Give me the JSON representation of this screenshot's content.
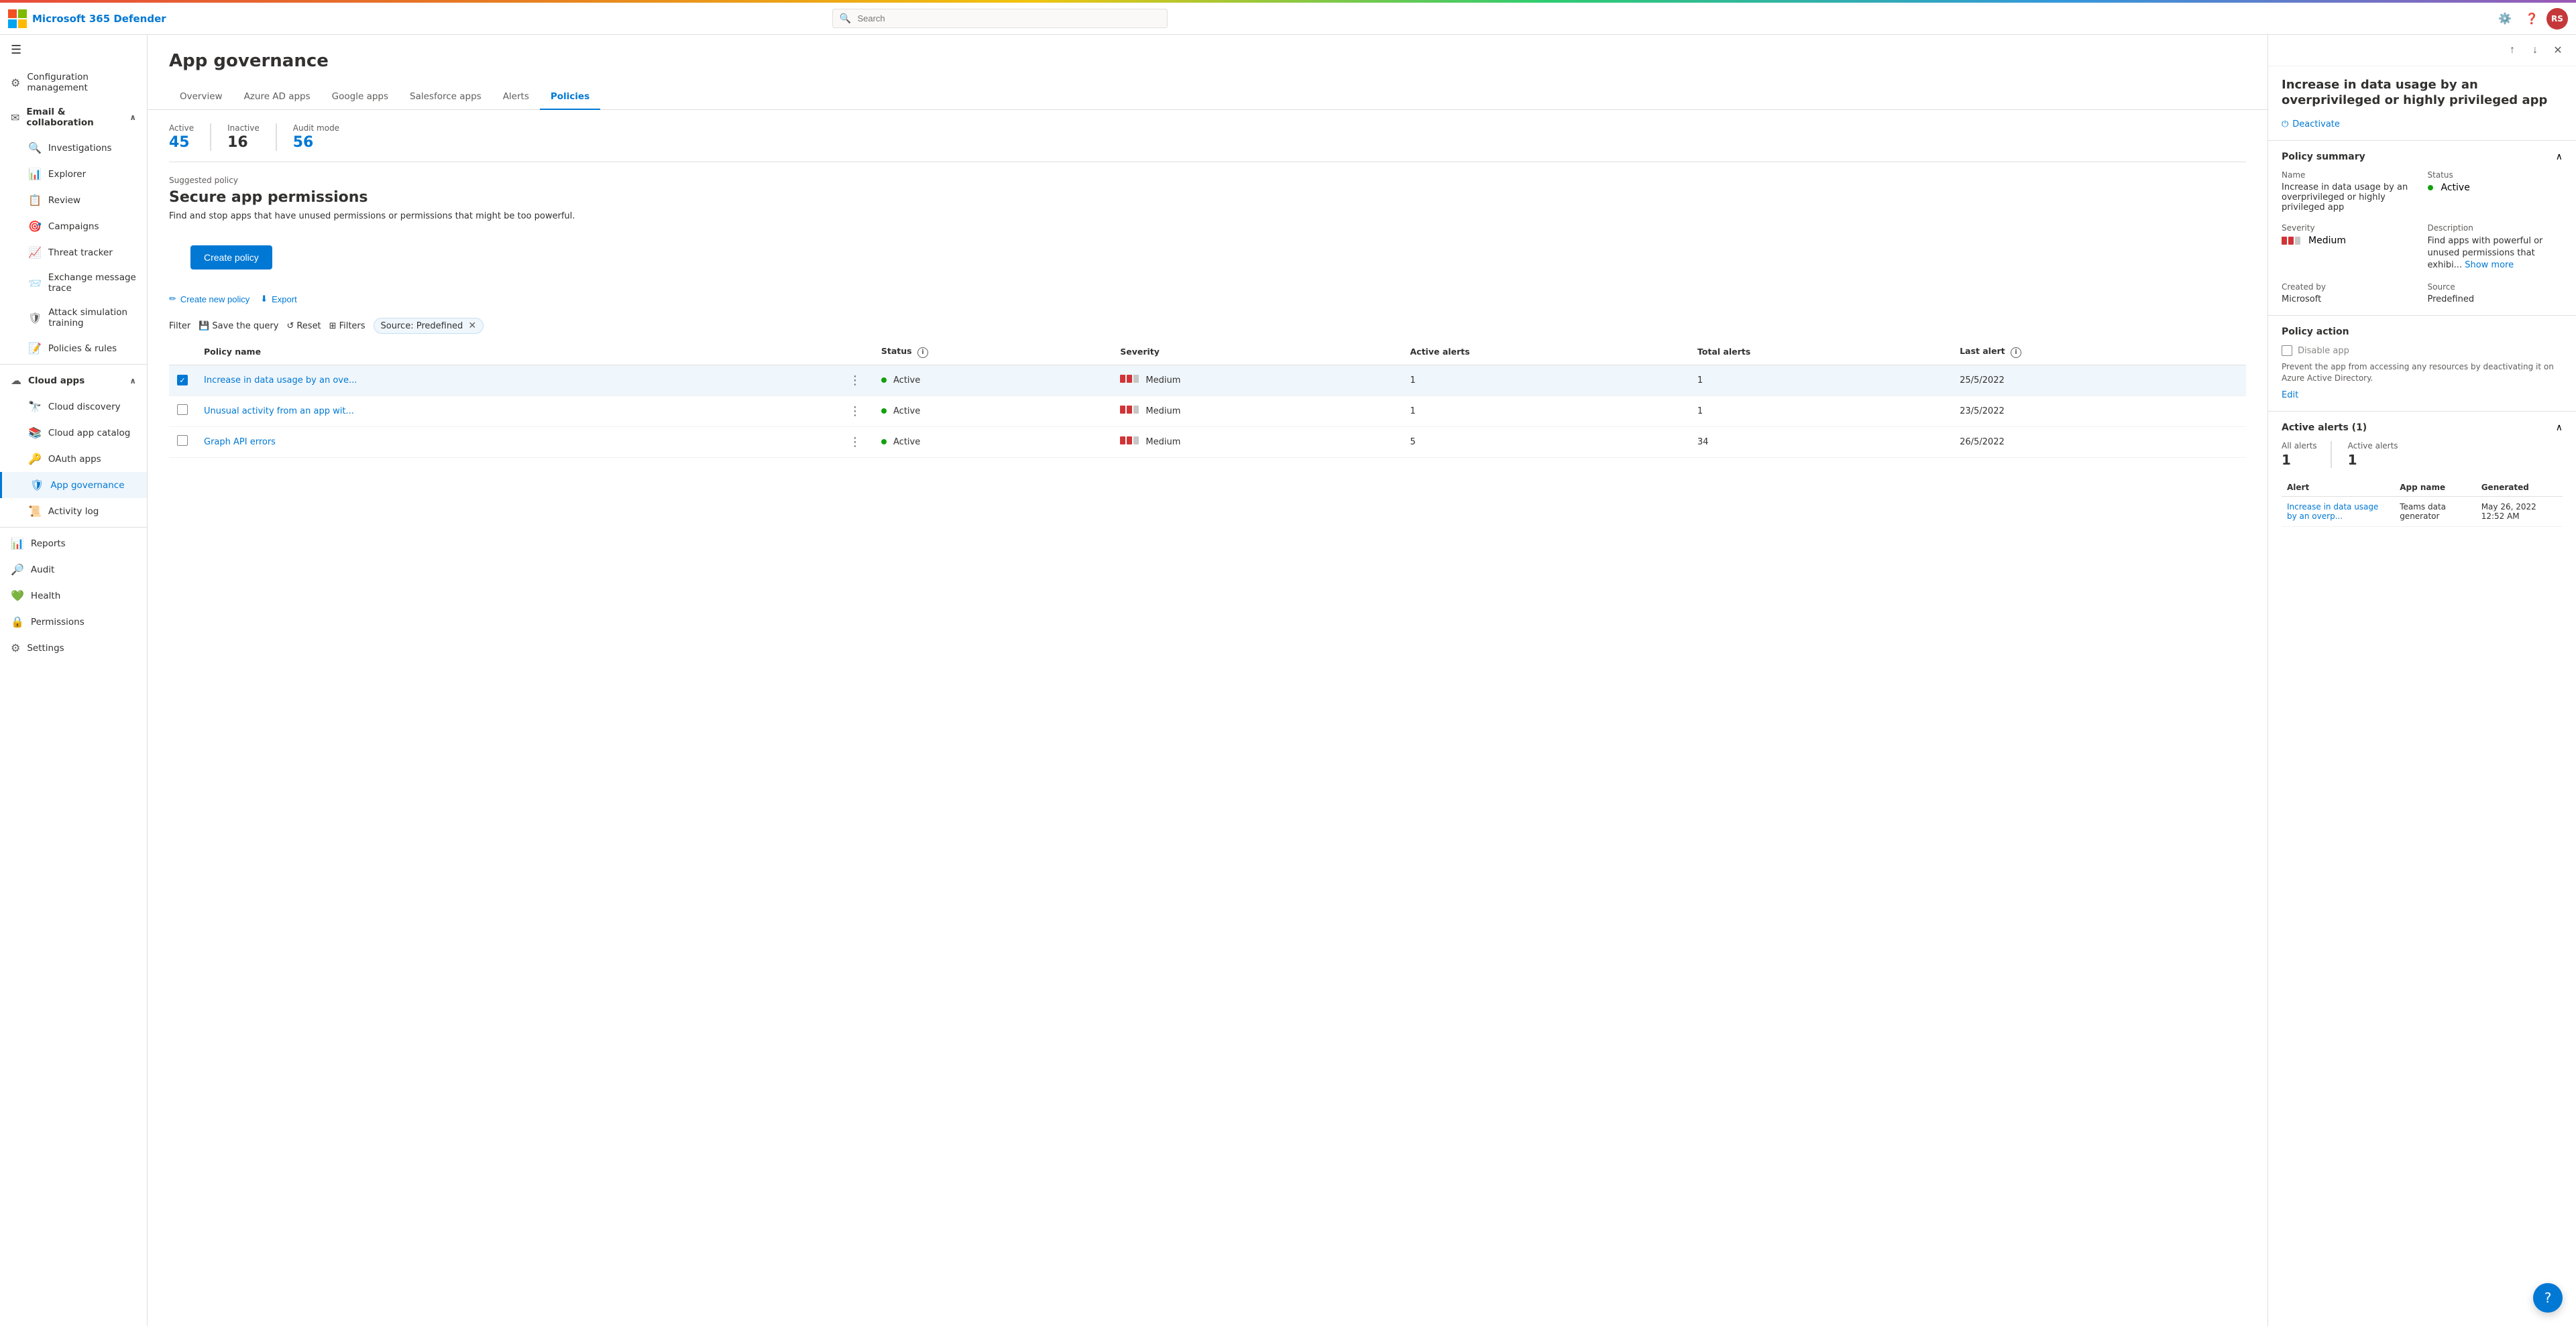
{
  "app": {
    "title": "Microsoft 365 Defender",
    "search_placeholder": "Search"
  },
  "topbar": {
    "title": "Microsoft 365 Defender",
    "user_initials": "RS",
    "settings_label": "Settings",
    "help_label": "Help"
  },
  "sidebar": {
    "hamburger_label": "Toggle navigation",
    "items": [
      {
        "id": "configuration-management",
        "label": "Configuration management",
        "icon": "⚙",
        "indent": false,
        "active": false
      },
      {
        "id": "email-collaboration",
        "label": "Email & collaboration",
        "icon": "✉",
        "indent": false,
        "active": false,
        "has_chevron": true,
        "expanded": true
      },
      {
        "id": "investigations",
        "label": "Investigations",
        "icon": "🔍",
        "indent": true,
        "active": false
      },
      {
        "id": "explorer",
        "label": "Explorer",
        "icon": "📊",
        "indent": true,
        "active": false
      },
      {
        "id": "review",
        "label": "Review",
        "icon": "📋",
        "indent": true,
        "active": false
      },
      {
        "id": "campaigns",
        "label": "Campaigns",
        "icon": "🎯",
        "indent": true,
        "active": false
      },
      {
        "id": "threat-tracker",
        "label": "Threat tracker",
        "icon": "📈",
        "indent": true,
        "active": false
      },
      {
        "id": "exchange-message-trace",
        "label": "Exchange message trace",
        "icon": "📨",
        "indent": true,
        "active": false
      },
      {
        "id": "attack-simulation-training",
        "label": "Attack simulation training",
        "icon": "🛡",
        "indent": true,
        "active": false
      },
      {
        "id": "policies-rules",
        "label": "Policies & rules",
        "icon": "📝",
        "indent": true,
        "active": false
      },
      {
        "id": "cloud-apps",
        "label": "Cloud apps",
        "icon": "☁",
        "indent": false,
        "active": false,
        "has_chevron": true,
        "expanded": true
      },
      {
        "id": "cloud-discovery",
        "label": "Cloud discovery",
        "icon": "🔭",
        "indent": true,
        "active": false
      },
      {
        "id": "cloud-app-catalog",
        "label": "Cloud app catalog",
        "icon": "📚",
        "indent": true,
        "active": false
      },
      {
        "id": "oauth-apps",
        "label": "OAuth apps",
        "icon": "🔑",
        "indent": true,
        "active": false
      },
      {
        "id": "app-governance",
        "label": "App governance",
        "icon": "🛡",
        "indent": true,
        "active": true
      },
      {
        "id": "activity-log",
        "label": "Activity log",
        "icon": "📜",
        "indent": true,
        "active": false
      },
      {
        "id": "reports",
        "label": "Reports",
        "icon": "📊",
        "indent": false,
        "active": false
      },
      {
        "id": "audit",
        "label": "Audit",
        "icon": "🔎",
        "indent": false,
        "active": false
      },
      {
        "id": "health",
        "label": "Health",
        "icon": "💚",
        "indent": false,
        "active": false
      },
      {
        "id": "permissions",
        "label": "Permissions",
        "icon": "🔒",
        "indent": false,
        "active": false
      },
      {
        "id": "settings",
        "label": "Settings",
        "icon": "⚙",
        "indent": false,
        "active": false
      }
    ]
  },
  "main": {
    "page_title": "App governance",
    "tabs": [
      {
        "id": "overview",
        "label": "Overview",
        "active": false
      },
      {
        "id": "azure-ad-apps",
        "label": "Azure AD apps",
        "active": false
      },
      {
        "id": "google-apps",
        "label": "Google apps",
        "active": false
      },
      {
        "id": "salesforce-apps",
        "label": "Salesforce apps",
        "active": false
      },
      {
        "id": "alerts",
        "label": "Alerts",
        "active": false
      },
      {
        "id": "policies",
        "label": "Policies",
        "active": true
      }
    ],
    "stats": [
      {
        "label": "Active",
        "value": "45",
        "color": "blue"
      },
      {
        "label": "Inactive",
        "value": "16",
        "color": "normal"
      },
      {
        "label": "Audit mode",
        "value": "56",
        "color": "blue"
      }
    ],
    "suggested_policy": {
      "label": "Suggested policy",
      "title": "Secure app permissions",
      "description": "Find and stop apps that have unused permissions or permissions that might be too powerful."
    },
    "create_policy_label": "Create policy",
    "table_actions": [
      {
        "id": "create-new-policy",
        "label": "Create new policy",
        "icon": "✏"
      },
      {
        "id": "export",
        "label": "Export",
        "icon": "⬇"
      }
    ],
    "filter": {
      "label": "Filter",
      "save_query": "Save the query",
      "reset": "Reset",
      "filters": "Filters",
      "active_filter": "Source: Predefined"
    },
    "table": {
      "columns": [
        {
          "id": "checkbox",
          "label": ""
        },
        {
          "id": "policy-name",
          "label": "Policy name"
        },
        {
          "id": "more",
          "label": ""
        },
        {
          "id": "status",
          "label": "Status"
        },
        {
          "id": "severity",
          "label": "Severity"
        },
        {
          "id": "active-alerts",
          "label": "Active alerts"
        },
        {
          "id": "total-alerts",
          "label": "Total alerts"
        },
        {
          "id": "last-alert",
          "label": "Last alert"
        }
      ],
      "rows": [
        {
          "id": "row1",
          "selected": true,
          "policy_name": "Increase in data usage by an ove...",
          "status": "Active",
          "severity": "Medium",
          "active_alerts": "1",
          "total_alerts": "1",
          "last_alert": "25/5/2022"
        },
        {
          "id": "row2",
          "selected": false,
          "policy_name": "Unusual activity from an app wit...",
          "status": "Active",
          "severity": "Medium",
          "active_alerts": "1",
          "total_alerts": "1",
          "last_alert": "23/5/2022"
        },
        {
          "id": "row3",
          "selected": false,
          "policy_name": "Graph API errors",
          "status": "Active",
          "severity": "Medium",
          "active_alerts": "5",
          "total_alerts": "34",
          "last_alert": "26/5/2022"
        }
      ]
    }
  },
  "panel": {
    "title": "Increase in data usage by an overprivileged or highly privileged app",
    "deactivate_label": "Deactivate",
    "policy_summary": {
      "section_title": "Policy summary",
      "name_label": "Name",
      "name_value": "Increase in data usage by an overprivileged or highly privileged app",
      "status_label": "Status",
      "status_value": "Active",
      "severity_label": "Severity",
      "severity_value": "Medium",
      "description_label": "Description",
      "description_value": "Find apps with powerful or unused permissions that exhibi...",
      "show_more_label": "Show more",
      "created_by_label": "Created by",
      "created_by_value": "Microsoft",
      "source_label": "Source",
      "source_value": "Predefined"
    },
    "policy_action": {
      "section_title": "Policy action",
      "disable_app_label": "Disable app",
      "disable_app_desc": "Prevent the app from accessing any resources by deactivating it on Azure Active Directory.",
      "edit_label": "Edit"
    },
    "active_alerts": {
      "section_title": "Active alerts (1)",
      "all_alerts_label": "All alerts",
      "all_alerts_count": "1",
      "active_alerts_label": "Active alerts",
      "active_alerts_count": "1",
      "table_columns": [
        {
          "id": "alert",
          "label": "Alert"
        },
        {
          "id": "app-name",
          "label": "App name"
        },
        {
          "id": "generated",
          "label": "Generated"
        }
      ],
      "table_rows": [
        {
          "alert": "Increase in data usage by an overp...",
          "app_name": "Teams data generator",
          "generated": "May 26, 2022 12:52 AM"
        }
      ]
    }
  },
  "help_bot": {
    "icon": "?"
  }
}
